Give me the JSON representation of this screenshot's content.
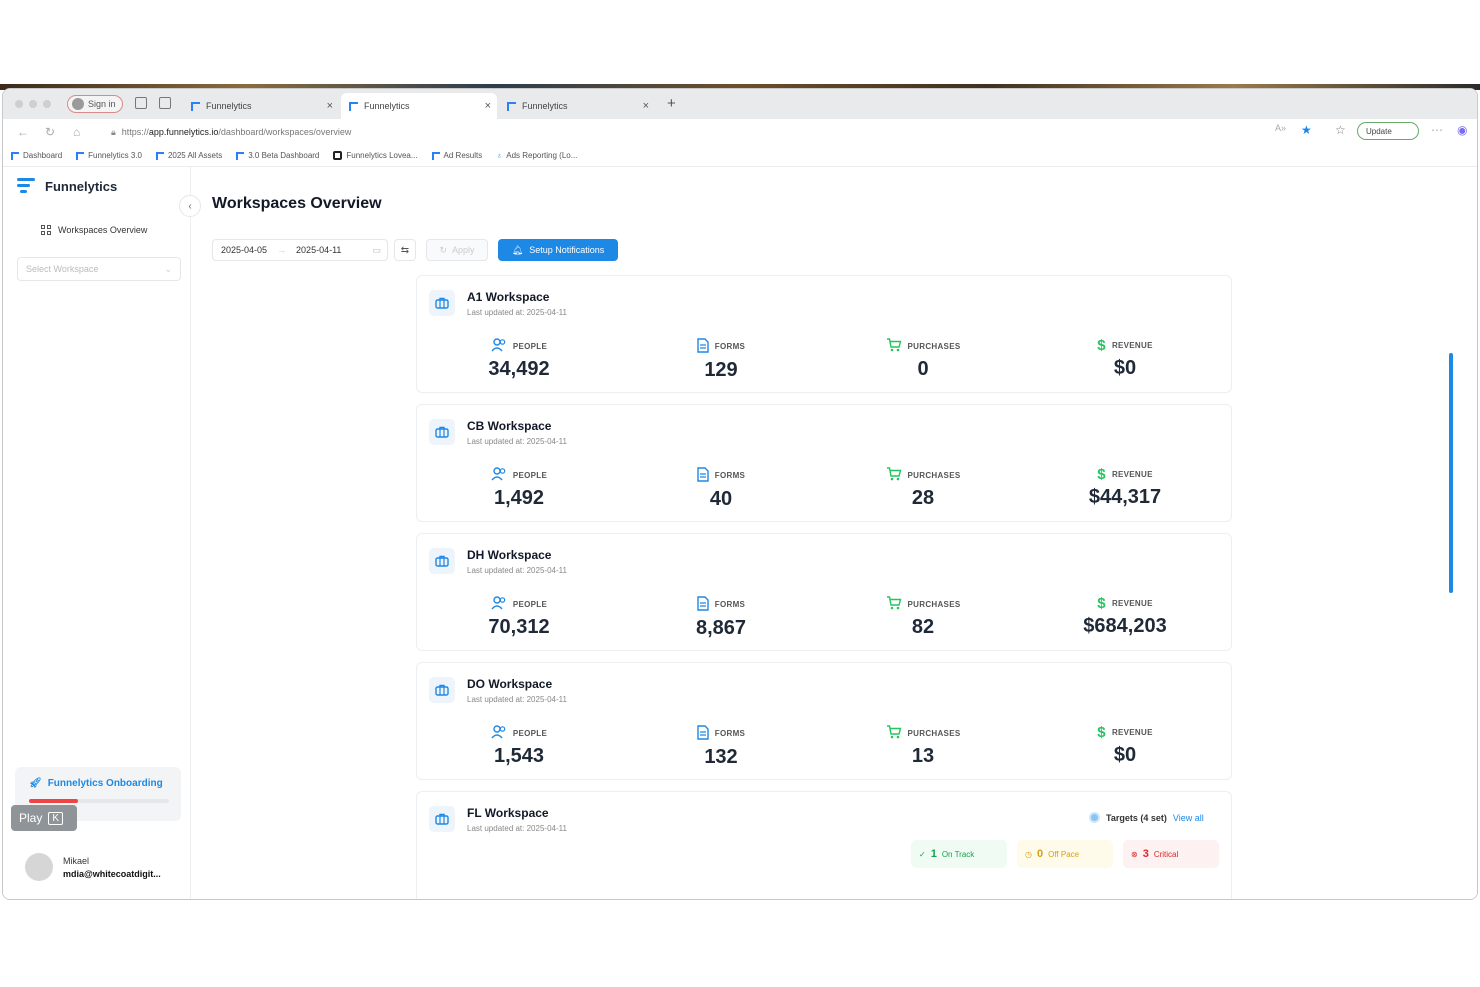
{
  "browser": {
    "signin_label": "Sign in",
    "tabs": [
      {
        "title": "Funnelytics"
      },
      {
        "title": "Funnelytics"
      },
      {
        "title": "Funnelytics"
      }
    ],
    "url_prefix": "https://",
    "url_host": "app.funnelytics.io",
    "url_path": "/dashboard/workspaces/overview",
    "update_label": "Update",
    "bookmarks": [
      "Dashboard",
      "Funnelytics 3.0",
      "2025 All Assets",
      "3.0 Beta Dashboard",
      "Funnelytics Lovea...",
      "Ad Results",
      "Ads Reporting (Lo..."
    ]
  },
  "sidebar": {
    "brand": "Funnelytics",
    "nav_item": "Workspaces Overview",
    "select_placeholder": "Select Workspace",
    "onboarding_label": "Funnelytics Onboarding",
    "onboarding_progress": 0.35,
    "user_name": "Mikael",
    "user_email": "mdia@whitecoatdigit..."
  },
  "overlay": {
    "play_label": "Play",
    "play_key": "K"
  },
  "header": {
    "title": "Workspaces Overview",
    "date_start": "2025-04-05",
    "date_end": "2025-04-11",
    "apply_label": "Apply",
    "notifications_label": "Setup Notifications"
  },
  "metric_labels": {
    "people": "PEOPLE",
    "forms": "FORMS",
    "purchases": "PURCHASES",
    "revenue": "REVENUE"
  },
  "workspaces": [
    {
      "name": "A1 Workspace",
      "updated": "Last updated at: 2025-04-11",
      "people": "34,492",
      "forms": "129",
      "purchases": "0",
      "revenue": "$0"
    },
    {
      "name": "CB Workspace",
      "updated": "Last updated at: 2025-04-11",
      "people": "1,492",
      "forms": "40",
      "purchases": "28",
      "revenue": "$44,317"
    },
    {
      "name": "DH Workspace",
      "updated": "Last updated at: 2025-04-11",
      "people": "70,312",
      "forms": "8,867",
      "purchases": "82",
      "revenue": "$684,203"
    },
    {
      "name": "DO Workspace",
      "updated": "Last updated at: 2025-04-11",
      "people": "1,543",
      "forms": "132",
      "purchases": "13",
      "revenue": "$0"
    },
    {
      "name": "FL Workspace",
      "updated": "Last updated at: 2025-04-11"
    }
  ],
  "targets": {
    "label": "Targets (4 set)",
    "view_all": "View all",
    "on_track_count": "1",
    "on_track_label": "On Track",
    "off_pace_count": "0",
    "off_pace_label": "Off Pace",
    "critical_count": "3",
    "critical_label": "Critical"
  },
  "colors": {
    "accent": "#1e88e5",
    "on_track": "#16a34a",
    "off_pace": "#d4a017",
    "critical": "#dc2626",
    "purchases_icon": "#22c55e",
    "revenue_icon": "#22c55e"
  }
}
